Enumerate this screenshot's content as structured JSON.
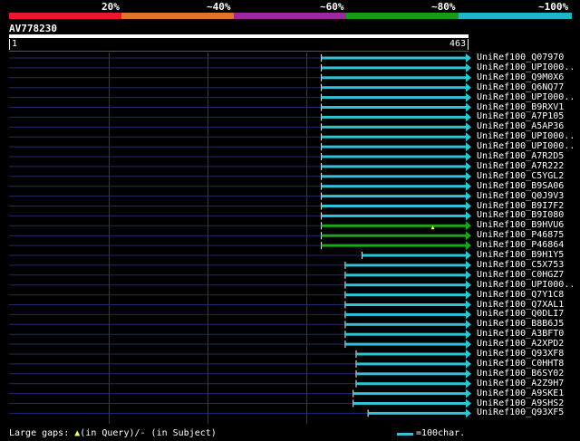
{
  "legend": {
    "labels": [
      "20%",
      "~40%",
      "~60%",
      "~80%",
      "~100%"
    ],
    "colors": [
      "#e8192c",
      "#e0742a",
      "#9a2a9a",
      "#1a9a1a",
      "#1cb8c8"
    ]
  },
  "query": {
    "id": "AV778230",
    "start": "1",
    "end": "463",
    "length": 463
  },
  "hits": [
    {
      "label": "UniRef100_Q07970",
      "start": 315,
      "end": 463,
      "color": "#2ec4d6"
    },
    {
      "label": "UniRef100_UPI000..",
      "start": 315,
      "end": 463,
      "color": "#2ec4d6"
    },
    {
      "label": "UniRef100_Q9M0X6",
      "start": 315,
      "end": 463,
      "color": "#2ec4d6"
    },
    {
      "label": "UniRef100_Q6NQ77",
      "start": 315,
      "end": 463,
      "color": "#2ec4d6"
    },
    {
      "label": "UniRef100_UPI000..",
      "start": 315,
      "end": 463,
      "color": "#2ec4d6"
    },
    {
      "label": "UniRef100_B9RXV1",
      "start": 315,
      "end": 463,
      "color": "#2ec4d6"
    },
    {
      "label": "UniRef100_A7P105",
      "start": 315,
      "end": 463,
      "color": "#2ec4d6"
    },
    {
      "label": "UniRef100_A5AP36",
      "start": 315,
      "end": 463,
      "color": "#2ec4d6"
    },
    {
      "label": "UniRef100_UPI000..",
      "start": 315,
      "end": 463,
      "color": "#2ec4d6"
    },
    {
      "label": "UniRef100_UPI000..",
      "start": 315,
      "end": 463,
      "color": "#2ec4d6"
    },
    {
      "label": "UniRef100_A7R2D5",
      "start": 315,
      "end": 463,
      "color": "#2ec4d6"
    },
    {
      "label": "UniRef100_A7R222",
      "start": 315,
      "end": 463,
      "color": "#2ec4d6"
    },
    {
      "label": "UniRef100_C5YGL2",
      "start": 315,
      "end": 463,
      "color": "#2ec4d6"
    },
    {
      "label": "UniRef100_B9SA06",
      "start": 315,
      "end": 463,
      "color": "#2ec4d6"
    },
    {
      "label": "UniRef100_Q0J9V3",
      "start": 315,
      "end": 463,
      "color": "#2ec4d6"
    },
    {
      "label": "UniRef100_B9I7F2",
      "start": 315,
      "end": 463,
      "color": "#2ec4d6"
    },
    {
      "label": "UniRef100_B9I080",
      "start": 315,
      "end": 463,
      "color": "#2ec4d6"
    },
    {
      "label": "UniRef100_B9HVU6",
      "start": 315,
      "end": 463,
      "color": "#1aa81a",
      "gap_at": 427
    },
    {
      "label": "UniRef100_P46875",
      "start": 315,
      "end": 463,
      "color": "#1aa81a"
    },
    {
      "label": "UniRef100_P46864",
      "start": 315,
      "end": 463,
      "color": "#1aa81a"
    },
    {
      "label": "UniRef100_B9H1Y5",
      "start": 356,
      "end": 463,
      "color": "#2ec4d6"
    },
    {
      "label": "UniRef100_C5X753",
      "start": 339,
      "end": 463,
      "color": "#2ec4d6"
    },
    {
      "label": "UniRef100_C0HGZ7",
      "start": 339,
      "end": 463,
      "color": "#2ec4d6"
    },
    {
      "label": "UniRef100_UPI000..",
      "start": 339,
      "end": 463,
      "color": "#2ec4d6"
    },
    {
      "label": "UniRef100_Q7Y1C8",
      "start": 339,
      "end": 463,
      "color": "#2ec4d6"
    },
    {
      "label": "UniRef100_Q7XAL1",
      "start": 339,
      "end": 463,
      "color": "#2ec4d6"
    },
    {
      "label": "UniRef100_Q0DLI7",
      "start": 339,
      "end": 463,
      "color": "#2ec4d6"
    },
    {
      "label": "UniRef100_B8B6J5",
      "start": 339,
      "end": 463,
      "color": "#2ec4d6"
    },
    {
      "label": "UniRef100_A3BFT0",
      "start": 339,
      "end": 463,
      "color": "#2ec4d6"
    },
    {
      "label": "UniRef100_A2XPD2",
      "start": 339,
      "end": 463,
      "color": "#2ec4d6"
    },
    {
      "label": "UniRef100_Q93XF8",
      "start": 350,
      "end": 463,
      "color": "#2ec4d6"
    },
    {
      "label": "UniRef100_C0HHT8",
      "start": 350,
      "end": 463,
      "color": "#2ec4d6"
    },
    {
      "label": "UniRef100_B6SY02",
      "start": 350,
      "end": 463,
      "color": "#2ec4d6"
    },
    {
      "label": "UniRef100_A2Z9H7",
      "start": 350,
      "end": 463,
      "color": "#2ec4d6"
    },
    {
      "label": "UniRef100_A9SKE1",
      "start": 347,
      "end": 463,
      "color": "#2ec4d6"
    },
    {
      "label": "UniRef100_A9SHS2",
      "start": 347,
      "end": 463,
      "color": "#2ec4d6"
    },
    {
      "label": "UniRef100_Q93XF5",
      "start": 362,
      "end": 463,
      "color": "#2ec4d6"
    }
  ],
  "footer": {
    "gap_legend_prefix": "Large gaps: ",
    "gap_query_symbol": "▲",
    "gap_legend_suffix": "(in Query)/- (in Subject)",
    "scale_key_label": "=100char."
  }
}
